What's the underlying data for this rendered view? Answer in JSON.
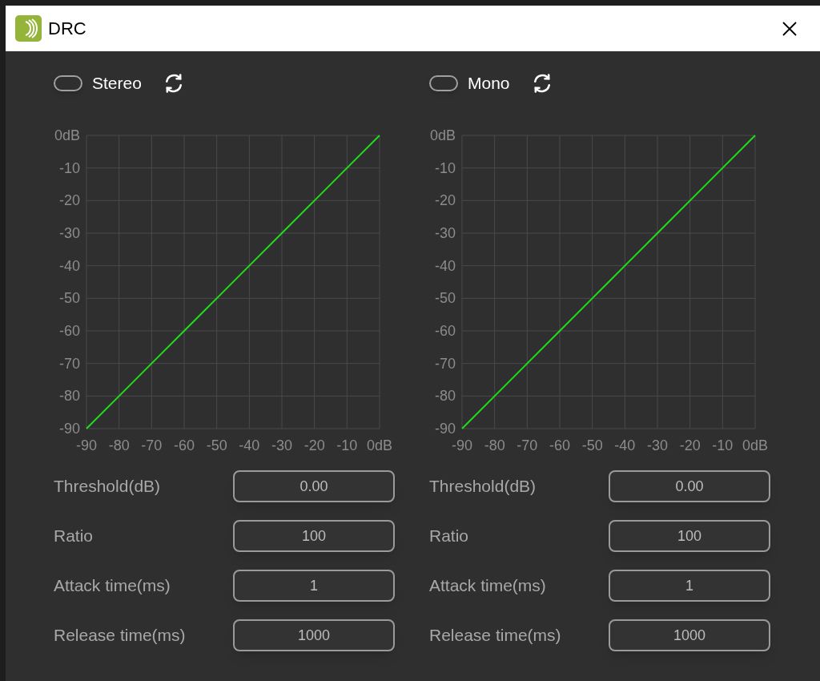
{
  "window": {
    "title": "DRC"
  },
  "panels": [
    {
      "toggle": {
        "label": "Stereo",
        "on": false
      },
      "chart_data": {
        "type": "line",
        "grid": true,
        "x": [
          -90,
          -80,
          -70,
          -60,
          -50,
          -40,
          -30,
          -20,
          -10,
          0
        ],
        "series": [
          {
            "color": "#1fdc1f",
            "values": [
              -90,
              -80,
              -70,
              -60,
              -50,
              -40,
              -30,
              -20,
              -10,
              0
            ]
          }
        ],
        "xlim": [
          -90,
          0
        ],
        "ylim": [
          -90,
          0
        ],
        "xticks": [
          -90,
          -80,
          -70,
          -60,
          -50,
          -40,
          -30,
          -20,
          -10,
          {
            "value": 0,
            "label": "0dB"
          }
        ],
        "yticks": [
          -90,
          -80,
          -70,
          -60,
          -50,
          -40,
          -30,
          -20,
          -10,
          {
            "value": 0,
            "label": "0dB"
          }
        ]
      },
      "fields": [
        {
          "label": "Threshold(dB)",
          "value": "0.00"
        },
        {
          "label": "Ratio",
          "value": "100"
        },
        {
          "label": "Attack time(ms)",
          "value": "1"
        },
        {
          "label": "Release time(ms)",
          "value": "1000"
        }
      ]
    },
    {
      "toggle": {
        "label": "Mono",
        "on": false
      },
      "chart_data": {
        "type": "line",
        "grid": true,
        "x": [
          -90,
          -80,
          -70,
          -60,
          -50,
          -40,
          -30,
          -20,
          -10,
          0
        ],
        "series": [
          {
            "color": "#1fdc1f",
            "values": [
              -90,
              -80,
              -70,
              -60,
              -50,
              -40,
              -30,
              -20,
              -10,
              0
            ]
          }
        ],
        "xlim": [
          -90,
          0
        ],
        "ylim": [
          -90,
          0
        ],
        "xticks": [
          -90,
          -80,
          -70,
          -60,
          -50,
          -40,
          -30,
          -20,
          -10,
          {
            "value": 0,
            "label": "0dB"
          }
        ],
        "yticks": [
          -90,
          -80,
          -70,
          -60,
          -50,
          -40,
          -30,
          -20,
          -10,
          {
            "value": 0,
            "label": "0dB"
          }
        ]
      },
      "fields": [
        {
          "label": "Threshold(dB)",
          "value": "0.00"
        },
        {
          "label": "Ratio",
          "value": "100"
        },
        {
          "label": "Attack time(ms)",
          "value": "1"
        },
        {
          "label": "Release time(ms)",
          "value": "1000"
        }
      ]
    }
  ]
}
